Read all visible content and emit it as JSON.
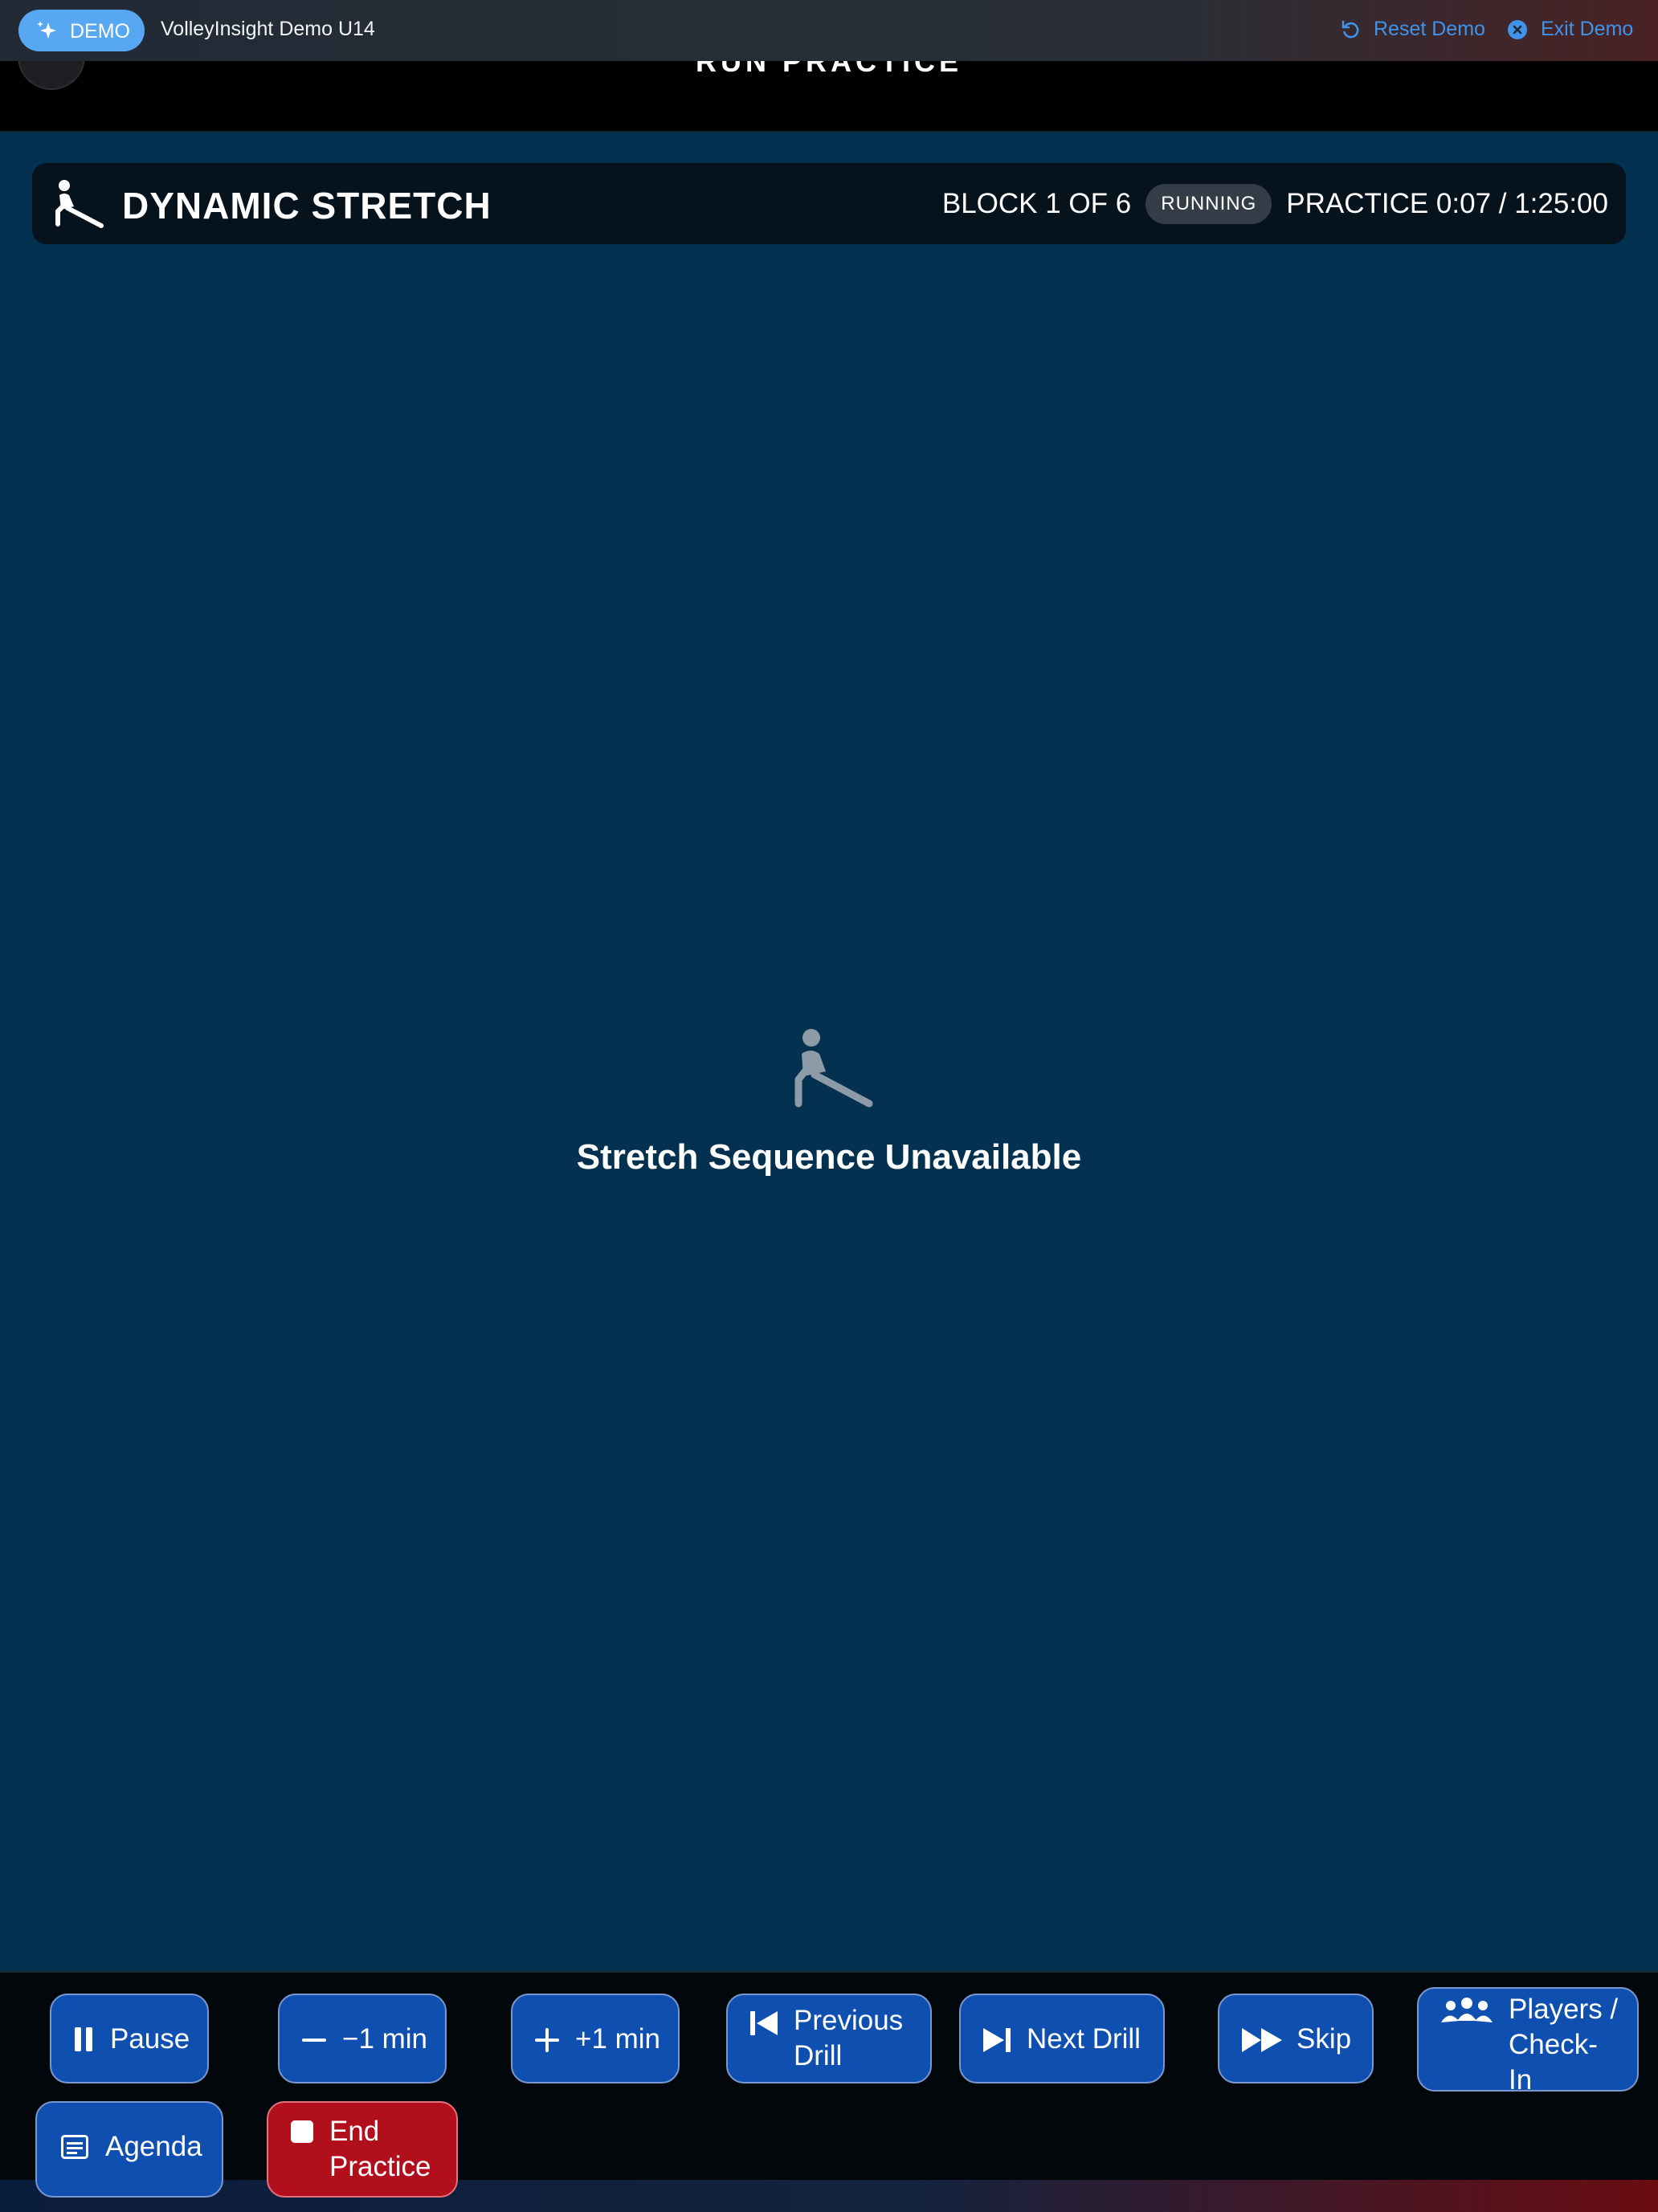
{
  "demo_bar": {
    "badge": "DEMO",
    "team": "VolleyInsight Demo U14",
    "reset_label": "Reset Demo",
    "exit_label": "Exit Demo"
  },
  "header": {
    "title": "RUN PRACTICE"
  },
  "block": {
    "title": "DYNAMIC STRETCH",
    "count": "BLOCK 1 OF 6",
    "status": "RUNNING",
    "practice_time": "PRACTICE 0:07 / 1:25:00"
  },
  "empty_state": {
    "message": "Stretch Sequence Unavailable"
  },
  "controls": {
    "pause": "Pause",
    "minus": "−1 min",
    "plus": "+1 min",
    "previous_1": "Previous",
    "previous_2": "Drill",
    "next": "Next Drill",
    "skip": "Skip",
    "players_1": "Players /",
    "players_2": "Check-",
    "players_3": "In",
    "agenda": "Agenda",
    "end_1": "End",
    "end_2": "Practice"
  },
  "colors": {
    "background": "#04314f",
    "button": "#0e4fb0",
    "danger": "#b10f1c",
    "demo_pill": "#58a7f2",
    "demo_link": "#3f93ea"
  },
  "icons": [
    "sparkle-icon",
    "reset-icon",
    "close-circle-icon",
    "stretch-icon",
    "pause-icon",
    "minus-icon",
    "plus-icon",
    "previous-icon",
    "next-icon",
    "skip-icon",
    "players-icon",
    "agenda-icon",
    "stop-icon"
  ]
}
